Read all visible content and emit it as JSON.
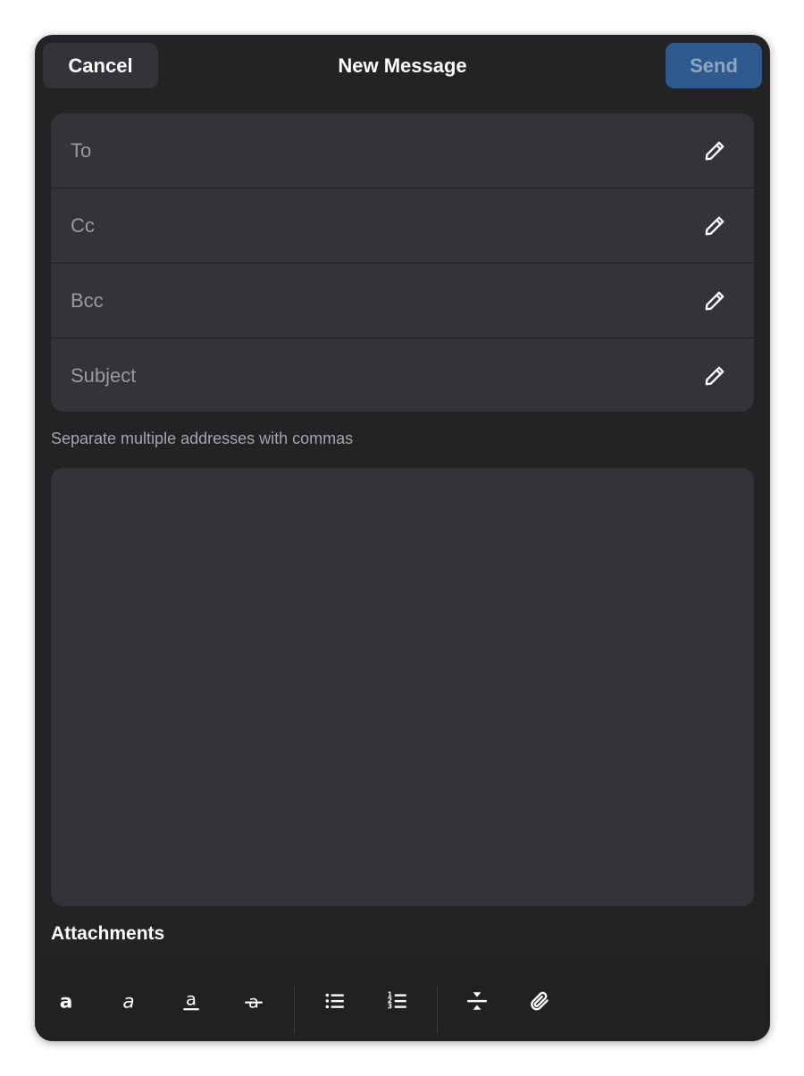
{
  "header": {
    "cancel_label": "Cancel",
    "title": "New Message",
    "send_label": "Send"
  },
  "fields": [
    {
      "name": "to",
      "placeholder": "To",
      "value": ""
    },
    {
      "name": "cc",
      "placeholder": "Cc",
      "value": ""
    },
    {
      "name": "bcc",
      "placeholder": "Bcc",
      "value": ""
    },
    {
      "name": "subject",
      "placeholder": "Subject",
      "value": ""
    }
  ],
  "hint": "Separate multiple addresses with commas",
  "body": {
    "value": ""
  },
  "attachments_label": "Attachments",
  "toolbar": {
    "tools": [
      "bold-icon",
      "italic-icon",
      "underline-icon",
      "strikethrough-icon",
      "bulleted-list-icon",
      "numbered-list-icon",
      "horizontal-rule-icon",
      "paperclip-icon"
    ]
  },
  "colors": {
    "background": "#232326",
    "surface": "#333338",
    "accent": "#2f5a8f",
    "text": "#ffffff",
    "muted": "#9a9aa0"
  }
}
